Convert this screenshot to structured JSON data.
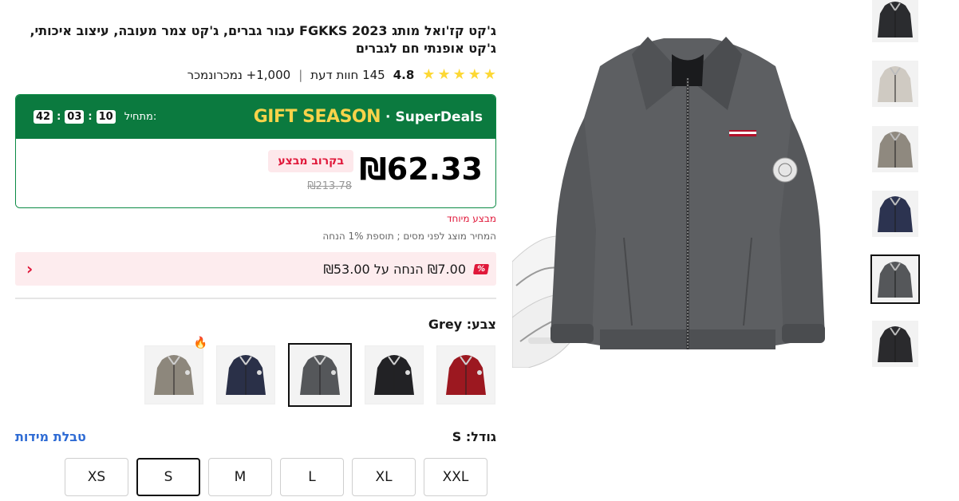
{
  "product": {
    "title": "ג'קט קז'ואל מותג FGKKS 2023 עבור גברים, ג'קט צמר מעובה, עיצוב איכותי, ג'קט אופנתי חם לגברים",
    "rating": "4.8",
    "rating_stars": 5,
    "reviews": "145 חוות דעת",
    "separator": "|",
    "sold": "1,000+ נמכרונמכר"
  },
  "deal": {
    "brand": "SuperDeals",
    "brand_dot": "·",
    "campaign": "GIFT SEASON",
    "countdown_label": "מתחיל:",
    "countdown": {
      "hours": "10",
      "minutes": "03",
      "seconds": "42"
    },
    "countdown_sep": ":",
    "price": "₪62.33",
    "old_price": "₪213.78",
    "badge": "בקרוב מבצע"
  },
  "special_label": "מבצע מיוחד",
  "tax_note": "המחיר מוצג לפני מסים ; תוספת 1% הנחה",
  "discount_bar": {
    "icon": "%",
    "text": "₪7.00 הנחה על ₪53.00",
    "chevron": "‹"
  },
  "color": {
    "label": "צבע: Grey",
    "swatches": [
      {
        "name": "Khaki",
        "color": "#8d877c",
        "hot": true
      },
      {
        "name": "Navy",
        "color": "#2a3048",
        "hot": false
      },
      {
        "name": "Grey",
        "color": "#55575a",
        "hot": false,
        "selected": true
      },
      {
        "name": "Black",
        "color": "#222225",
        "hot": false
      },
      {
        "name": "Red",
        "color": "#9c1820",
        "hot": false
      }
    ],
    "hot_icon": "🔥"
  },
  "size": {
    "label": "גודל: S",
    "chart_link": "טבלת מידות",
    "options": [
      "XS",
      "S",
      "M",
      "L",
      "XL",
      "XXL"
    ],
    "selected": "S"
  },
  "gallery": {
    "thumb_colors": [
      "#2b2c2f",
      "#cfcac2",
      "#8f897f",
      "#2c3350",
      "#55575a",
      "#2a2a2d"
    ],
    "selected_index": 4
  },
  "colors": {
    "accent_red": "#e0183a",
    "deal_green": "#0b7a3f",
    "gold": "#f7d34a",
    "link_blue": "#2e6bd4"
  }
}
